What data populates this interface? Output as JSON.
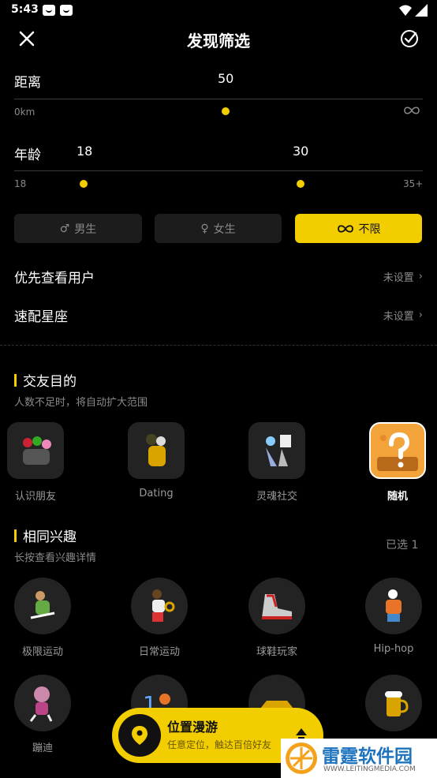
{
  "status": {
    "time": "5:43"
  },
  "header": {
    "title": "发现筛选"
  },
  "distance": {
    "label": "距离",
    "value": "50",
    "min": "0km",
    "max_icon": "infinity-icon"
  },
  "age": {
    "label": "年龄",
    "low": "18",
    "high": "30",
    "min": "18",
    "max": "35+"
  },
  "gender": {
    "options": [
      {
        "label": "男生",
        "icon": "male-icon"
      },
      {
        "label": "女生",
        "icon": "female-icon"
      },
      {
        "label": "不限",
        "icon": "infinity-icon"
      }
    ],
    "selected": "不限"
  },
  "prefs": [
    {
      "label": "优先查看用户",
      "value": "未设置"
    },
    {
      "label": "速配星座",
      "value": "未设置"
    }
  ],
  "purpose": {
    "title": "交友目的",
    "subtitle": "人数不足时，将自动扩大范围",
    "items": [
      {
        "label": "认识朋友",
        "icon": "group-friends-icon"
      },
      {
        "label": "Dating",
        "icon": "couple-hug-icon"
      },
      {
        "label": "灵魂社交",
        "icon": "soul-social-icon"
      },
      {
        "label": "随机",
        "icon": "question-mark-icon"
      }
    ],
    "selected": "随机"
  },
  "interests": {
    "title": "相同兴趣",
    "subtitle": "长按查看兴趣详情",
    "selected_count": "已选 1",
    "items": [
      {
        "label": "极限运动",
        "icon": "extreme-sport-icon"
      },
      {
        "label": "日常运动",
        "icon": "daily-sport-icon"
      },
      {
        "label": "球鞋玩家",
        "icon": "sneaker-icon"
      },
      {
        "label": "Hip-hop",
        "icon": "hiphop-icon"
      },
      {
        "label": "蹦迪",
        "icon": "disco-icon"
      }
    ]
  },
  "banner": {
    "title": "位置漫游",
    "subtitle": "任意定位，触达百倍好友"
  },
  "watermark": {
    "title": "雷霆软件园",
    "url": "WWW.LEITINGMEDIA.COM"
  },
  "colors": {
    "accent": "#f2cd00",
    "background": "#000000",
    "card": "#232323"
  }
}
